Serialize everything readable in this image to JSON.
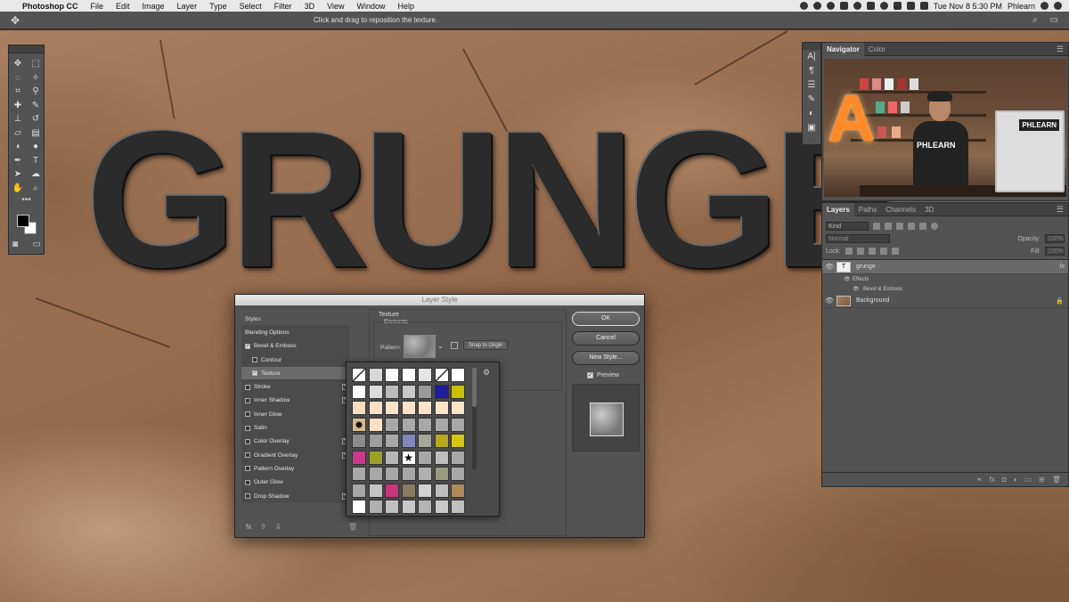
{
  "menubar": {
    "apple": "",
    "app_name": "Photoshop CC",
    "items": [
      "File",
      "Edit",
      "Image",
      "Layer",
      "Type",
      "Select",
      "Filter",
      "3D",
      "View",
      "Window",
      "Help"
    ],
    "clock": "Tue Nov 8  5:30 PM",
    "user": "Phlearn"
  },
  "options_bar": {
    "move_tool_icon": "✥",
    "hint": "Click and drag to reposition the texture."
  },
  "canvas": {
    "text": "GRUNGE"
  },
  "navigator": {
    "tabs": [
      "Navigator",
      "Color"
    ],
    "letter": "A",
    "shirt_text": "PHLEARN",
    "monitor_label": "PHLEARN"
  },
  "layers_panel": {
    "tabs": [
      "Layers",
      "Paths",
      "Channels",
      "3D"
    ],
    "filter_kind": "Kind",
    "blend_mode": "Normal",
    "opacity_label": "Opacity:",
    "opacity_value": "100%",
    "lock_label": "Lock:",
    "fill_label": "Fill:",
    "fill_value": "100%",
    "layers": [
      {
        "name": "grunge",
        "thumb": "T",
        "fx": "fx"
      },
      {
        "name": "Background"
      }
    ],
    "effects_label": "Effects",
    "effect_item": "Bevel & Emboss"
  },
  "dialog": {
    "title": "Layer Style",
    "styles": [
      {
        "label": "Styles"
      },
      {
        "label": "Blending Options"
      },
      {
        "label": "Bevel & Emboss",
        "checked": true
      },
      {
        "label": "Contour",
        "checked": false
      },
      {
        "label": "Texture",
        "checked": true
      },
      {
        "label": "Stroke",
        "checked": false
      },
      {
        "label": "Inner Shadow",
        "checked": false
      },
      {
        "label": "Inner Glow",
        "checked": false
      },
      {
        "label": "Satin",
        "checked": false
      },
      {
        "label": "Color Overlay",
        "checked": false
      },
      {
        "label": "Gradient Overlay",
        "checked": false
      },
      {
        "label": "Pattern Overlay",
        "checked": false
      },
      {
        "label": "Outer Glow",
        "checked": false
      },
      {
        "label": "Drop Shadow",
        "checked": false
      }
    ],
    "section_title": "Texture",
    "section_sub": "Elements",
    "pattern_label": "Pattern:",
    "snap_button": "Snap to Origin",
    "ok": "OK",
    "cancel": "Cancel",
    "new_style": "New Style...",
    "preview_label": "Preview",
    "fx_label": "fx"
  },
  "pattern_colors": [
    "#f4f4f4",
    "#d8d8d8",
    "#fafafa",
    "#ffffff",
    "#e6e6e6",
    "#d0d0d0",
    "#ffffff",
    "#ffffff",
    "#dcdcdc",
    "#bcbcbc",
    "#c8c8c8",
    "#9a9a9a",
    "#1d1d9e",
    "#c9c100",
    "#f9dcc0",
    "#fbe0c4",
    "#fde3c8",
    "#fde3c8",
    "#fde3c8",
    "#fde3c8",
    "#fde3c8",
    "#d9b98f",
    "#fbe0c4",
    "#a8a8a8",
    "#a8a8a8",
    "#a8a8a8",
    "#a8a8a8",
    "#a8a8a8",
    "#8c8c8c",
    "#9e9e9e",
    "#a8a8a8",
    "#7f88b8",
    "#a6a69a",
    "#b9a91a",
    "#d5c710",
    "#c83a8e",
    "#9aa02a",
    "#b6b6b6",
    "#ffffff",
    "#a7a7a7",
    "#bdbdbd",
    "#a8a8a8",
    "#a8a8a8",
    "#a8a8a8",
    "#a8a8a8",
    "#a8a8a8",
    "#b0b0b0",
    "#9a9a80",
    "#a8a8a8",
    "#a6a6a6",
    "#c4c4c4",
    "#c8367a",
    "#8a7a62",
    "#d2d2d2",
    "#bcbcbc",
    "#b08a5a",
    "#ffffff",
    "#b0b0b0",
    "#c0c0c0",
    "#c8c8c8",
    "#b4b4b4",
    "#c8c8c8",
    "#c0c0c0"
  ],
  "ui_colors": {
    "panel": "#535353",
    "dark": "#424242",
    "canvas_brown": "#a97d5e"
  }
}
